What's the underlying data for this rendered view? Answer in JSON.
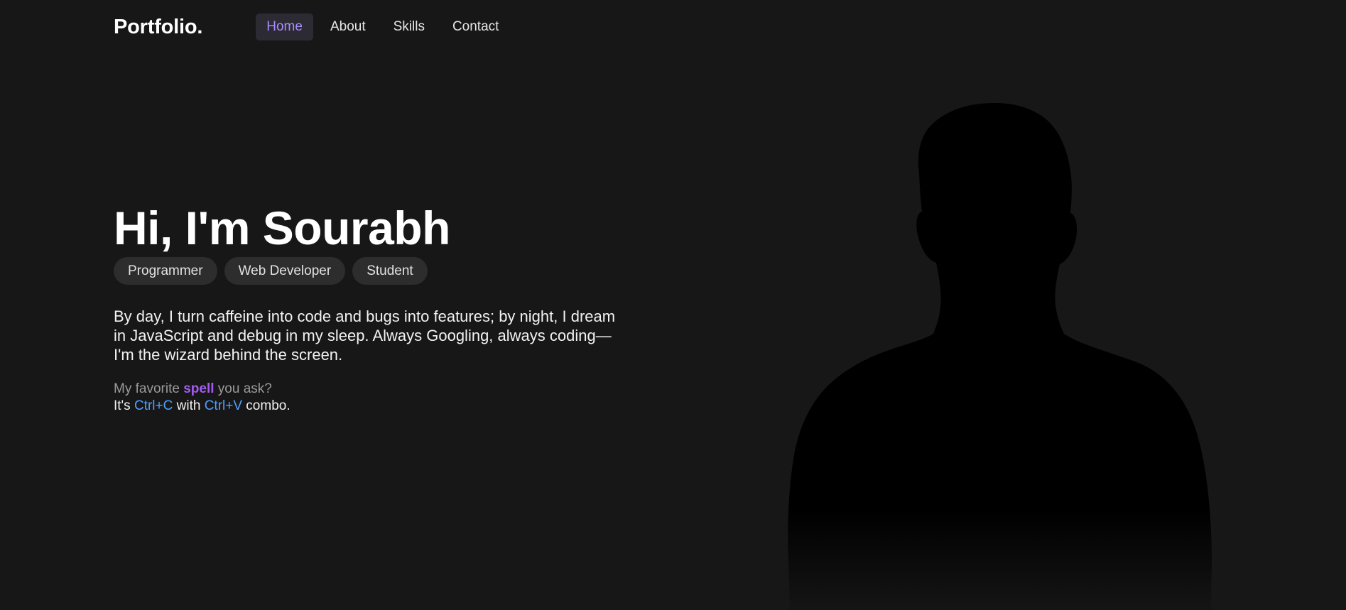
{
  "header": {
    "logo": "Portfolio.",
    "nav": [
      {
        "label": "Home",
        "active": true
      },
      {
        "label": "About",
        "active": false
      },
      {
        "label": "Skills",
        "active": false
      },
      {
        "label": "Contact",
        "active": false
      }
    ]
  },
  "hero": {
    "title": "Hi, I'm Sourabh",
    "tags": [
      "Programmer",
      "Web Developer",
      "Student"
    ],
    "bio": "By day, I turn caffeine into code and bugs into features; by night, I dream in JavaScript and debug in my sleep. Always Googling, always coding—I'm the wizard behind the screen.",
    "spell_prefix": "My favorite ",
    "spell_word": "spell",
    "spell_suffix": " you ask?",
    "combo_prefix": "It's ",
    "combo_key1": "Ctrl+C",
    "combo_mid": " with ",
    "combo_key2": "Ctrl+V",
    "combo_suffix": " combo."
  },
  "colors": {
    "background": "#171717",
    "accent_purple": "#a98cff",
    "spell_purple": "#a45cf0",
    "key_blue": "#4ea0ff",
    "tag_bg": "#2d2d2d"
  },
  "icons": {
    "profile": "person-silhouette"
  }
}
